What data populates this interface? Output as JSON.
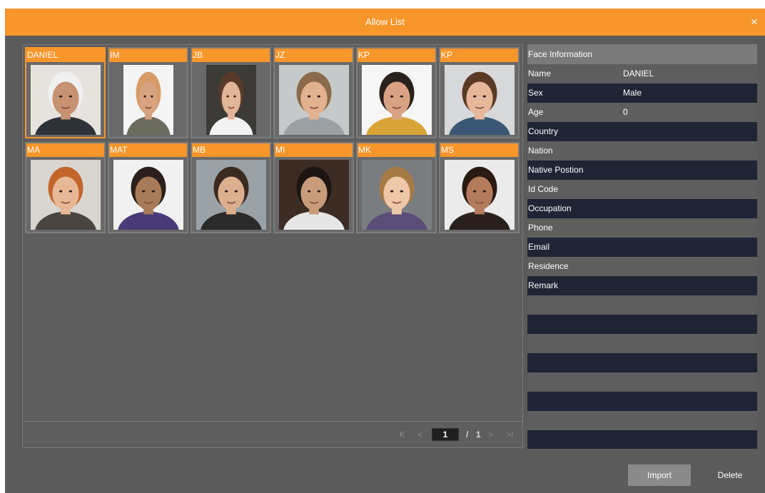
{
  "window": {
    "title": "Allow List",
    "close_glyph": "×"
  },
  "faces": [
    {
      "label": "DANIEL",
      "selected": true,
      "bg": "#e6e3df",
      "skin": "#c79272",
      "hair": "#f0f0f0",
      "shirt": "#2d3238"
    },
    {
      "label": "IM",
      "selected": false,
      "bg": "#f4f4f4",
      "skin": "#d6a27f",
      "hair": "#d79b67",
      "shirt": "#6b6b5f"
    },
    {
      "label": "JB",
      "selected": false,
      "bg": "#3b3a37",
      "skin": "#e2b596",
      "hair": "#5a3a2a",
      "shirt": "#f2f2f2"
    },
    {
      "label": "JZ",
      "selected": false,
      "bg": "#c6c9ca",
      "skin": "#e2b18f",
      "hair": "#8a6a4a",
      "shirt": "#9aa0a4"
    },
    {
      "label": "KP",
      "selected": false,
      "bg": "#f6f6f6",
      "skin": "#d9a383",
      "hair": "#2a211c",
      "shirt": "#d9a536"
    },
    {
      "label": "KP",
      "selected": false,
      "bg": "#d7d8d9",
      "skin": "#e7b799",
      "hair": "#5a3a25",
      "shirt": "#3a5875"
    },
    {
      "label": "MA",
      "selected": false,
      "bg": "#d9d6d1",
      "skin": "#e7b796",
      "hair": "#c3652a",
      "shirt": "#4a4540"
    },
    {
      "label": "MAT",
      "selected": false,
      "bg": "#f1f1f1",
      "skin": "#a77a58",
      "hair": "#2a1f1a",
      "shirt": "#4b3a78"
    },
    {
      "label": "MB",
      "selected": false,
      "bg": "#9aa2a8",
      "skin": "#dcaf8e",
      "hair": "#3a2a20",
      "shirt": "#2a2a2a"
    },
    {
      "label": "MI",
      "selected": false,
      "bg": "#3d2c24",
      "skin": "#c89b7b",
      "hair": "#1c1512",
      "shirt": "#e6e6e6"
    },
    {
      "label": "MK",
      "selected": false,
      "bg": "#7a7d80",
      "skin": "#eec6a8",
      "hair": "#a67a45",
      "shirt": "#5b4c78"
    },
    {
      "label": "MS",
      "selected": false,
      "bg": "#ebebeb",
      "skin": "#b47c5c",
      "hair": "#2a1a12",
      "shirt": "#2a211c"
    }
  ],
  "pager": {
    "first_glyph": "K",
    "prev_glyph": "<",
    "current_page": "1",
    "separator": "/",
    "total_pages": "1",
    "next_glyph": ">",
    "last_glyph": ">I"
  },
  "info": {
    "header": "Face Information",
    "rows": [
      {
        "key": "Name",
        "value": "DANIEL"
      },
      {
        "key": "Sex",
        "value": "Male"
      },
      {
        "key": "Age",
        "value": "0"
      },
      {
        "key": "Country",
        "value": ""
      },
      {
        "key": "Nation",
        "value": ""
      },
      {
        "key": "Native Postion",
        "value": ""
      },
      {
        "key": "Id Code",
        "value": ""
      },
      {
        "key": "Occupation",
        "value": ""
      },
      {
        "key": "Phone",
        "value": ""
      },
      {
        "key": "Email",
        "value": ""
      },
      {
        "key": "Residence",
        "value": ""
      },
      {
        "key": "Remark",
        "value": ""
      },
      {
        "key": "",
        "value": ""
      },
      {
        "key": "",
        "value": ""
      },
      {
        "key": "",
        "value": ""
      },
      {
        "key": "",
        "value": ""
      },
      {
        "key": "",
        "value": ""
      },
      {
        "key": "",
        "value": ""
      },
      {
        "key": "",
        "value": ""
      },
      {
        "key": "",
        "value": ""
      }
    ]
  },
  "buttons": {
    "import_label": "Import",
    "delete_label": "Delete"
  },
  "colors": {
    "accent": "#f7962a",
    "panel": "#5b5b5b",
    "row_dark": "#1f2535"
  }
}
